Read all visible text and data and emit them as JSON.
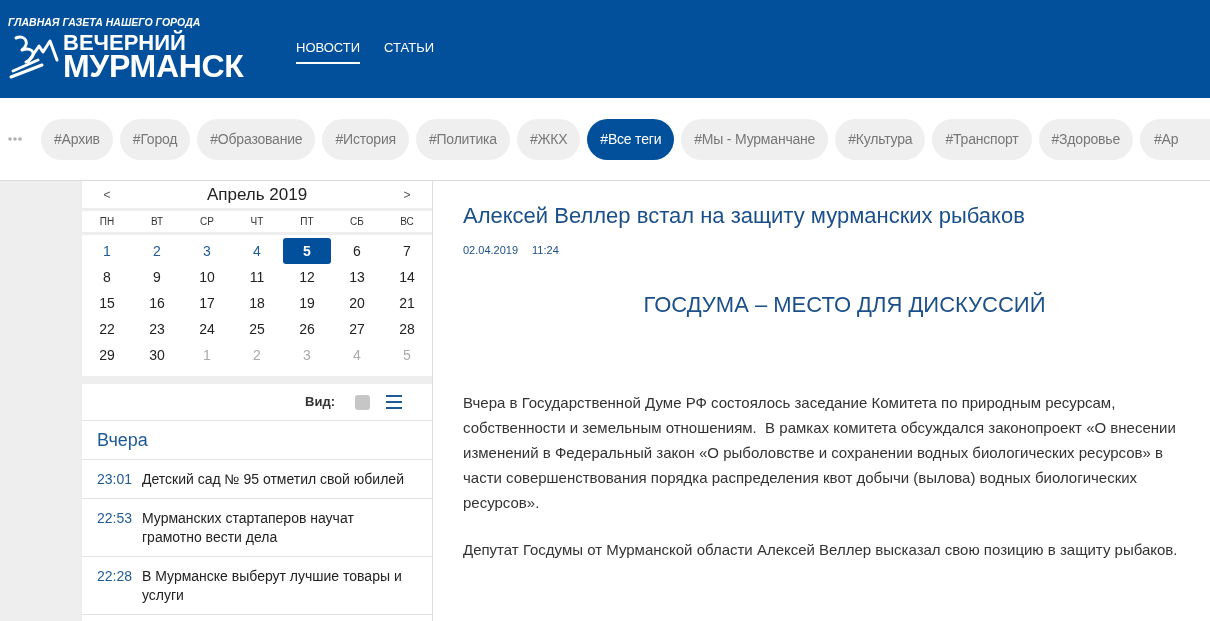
{
  "header": {
    "tagline": "ГЛАВНАЯ ГАЗЕТА НАШЕГО ГОРОДА",
    "logo_line_1": "ВЕЧЕРНИЙ",
    "logo_line_2": "МУРМАНСК",
    "nav": [
      {
        "label": "НОВОСТИ",
        "selected": true
      },
      {
        "label": "СТАТЬИ",
        "selected": false
      }
    ]
  },
  "tags": [
    {
      "label": "#Архив",
      "selected": false
    },
    {
      "label": "#Город",
      "selected": false
    },
    {
      "label": "#Образование",
      "selected": false
    },
    {
      "label": "#История",
      "selected": false
    },
    {
      "label": "#Политика",
      "selected": false
    },
    {
      "label": "#ЖКХ",
      "selected": false
    },
    {
      "label": "#Все теги",
      "selected": true
    },
    {
      "label": "#Мы - Мурманчане",
      "selected": false
    },
    {
      "label": "#Культура",
      "selected": false
    },
    {
      "label": "#Транспорт",
      "selected": false
    },
    {
      "label": "#Здоровье",
      "selected": false
    },
    {
      "label": "#Ар",
      "selected": false
    }
  ],
  "calendar": {
    "prev": "<",
    "title": "Апрель 2019",
    "next": ">",
    "weekdays": [
      "ПН",
      "ВТ",
      "СР",
      "ЧТ",
      "ПТ",
      "СБ",
      "ВС"
    ],
    "days": [
      {
        "label": "1",
        "kind": "news",
        "selected": false
      },
      {
        "label": "2",
        "kind": "news",
        "selected": false
      },
      {
        "label": "3",
        "kind": "news",
        "selected": false
      },
      {
        "label": "4",
        "kind": "news",
        "selected": false
      },
      {
        "label": "5",
        "kind": "news",
        "selected": true
      },
      {
        "label": "6",
        "kind": "plain",
        "selected": false
      },
      {
        "label": "7",
        "kind": "plain",
        "selected": false
      },
      {
        "label": "8",
        "kind": "plain",
        "selected": false
      },
      {
        "label": "9",
        "kind": "plain",
        "selected": false
      },
      {
        "label": "10",
        "kind": "plain",
        "selected": false
      },
      {
        "label": "11",
        "kind": "plain",
        "selected": false
      },
      {
        "label": "12",
        "kind": "plain",
        "selected": false
      },
      {
        "label": "13",
        "kind": "plain",
        "selected": false
      },
      {
        "label": "14",
        "kind": "plain",
        "selected": false
      },
      {
        "label": "15",
        "kind": "plain",
        "selected": false
      },
      {
        "label": "16",
        "kind": "plain",
        "selected": false
      },
      {
        "label": "17",
        "kind": "plain",
        "selected": false
      },
      {
        "label": "18",
        "kind": "plain",
        "selected": false
      },
      {
        "label": "19",
        "kind": "plain",
        "selected": false
      },
      {
        "label": "20",
        "kind": "plain",
        "selected": false
      },
      {
        "label": "21",
        "kind": "plain",
        "selected": false
      },
      {
        "label": "22",
        "kind": "plain",
        "selected": false
      },
      {
        "label": "23",
        "kind": "plain",
        "selected": false
      },
      {
        "label": "24",
        "kind": "plain",
        "selected": false
      },
      {
        "label": "25",
        "kind": "plain",
        "selected": false
      },
      {
        "label": "26",
        "kind": "plain",
        "selected": false
      },
      {
        "label": "27",
        "kind": "plain",
        "selected": false
      },
      {
        "label": "28",
        "kind": "plain",
        "selected": false
      },
      {
        "label": "29",
        "kind": "plain",
        "selected": false
      },
      {
        "label": "30",
        "kind": "plain",
        "selected": false
      },
      {
        "label": "1",
        "kind": "outside",
        "selected": false
      },
      {
        "label": "2",
        "kind": "outside",
        "selected": false
      },
      {
        "label": "3",
        "kind": "outside",
        "selected": false
      },
      {
        "label": "4",
        "kind": "outside",
        "selected": false
      },
      {
        "label": "5",
        "kind": "outside",
        "selected": false
      }
    ]
  },
  "news_list": {
    "view_label": "Вид:",
    "view_options": [
      {
        "kind": "tile",
        "selected": false
      },
      {
        "kind": "list",
        "selected": true
      }
    ],
    "day_heading": "Вчера",
    "items": [
      {
        "time": "23:01",
        "title": "Детский сад № 95 отметил свой юбилей"
      },
      {
        "time": "22:53",
        "title": "Мурманских стартаперов научат грамотно вести дела"
      },
      {
        "time": "22:28",
        "title": "В Мурманске выберут лучшие товары и услуги"
      }
    ]
  },
  "article": {
    "title": "Алексей Веллер встал на защиту мурманских рыбаков",
    "date": "02.04.2019",
    "time": "11:24",
    "subtitle": "ГОСДУМА – МЕСТО ДЛЯ ДИСКУССИЙ",
    "paragraphs": [
      "Вчера в Государственной Думе РФ состоялось заседание Комитета по природным ресурсам, собственности и земельным отношениям.  В рамках комитета обсуждался законопроект «О внесении изменений в Федеральный закон «О рыболовстве и сохранении водных биологических ресурсов» в части совершенствования порядка распределения квот добычи (вылова) водных биологических ресурсов».",
      "Депутат Госдумы от Мурманской области Алексей Веллер высказал свою позицию в защиту рыбаков."
    ]
  }
}
